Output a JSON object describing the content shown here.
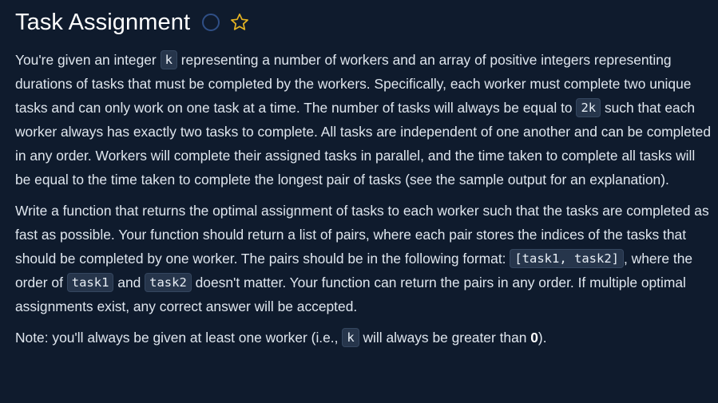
{
  "header": {
    "title": "Task Assignment",
    "status_icon": "circle-outline-icon",
    "favorite_icon": "star-outline-icon",
    "colors": {
      "background": "#0f1b2d",
      "circle": "#2f4f86",
      "star": "#e6b422"
    }
  },
  "body": {
    "p1": {
      "t1": "You're given an integer ",
      "c1": "k",
      "t2": " representing a number of workers and an array of positive integers representing durations of tasks that must be completed by the workers. Specifically, each worker must complete two unique tasks and can only work on one task at a time. The number of tasks will always be equal to ",
      "c2": "2k",
      "t3": " such that each worker always has exactly two tasks to complete. All tasks are independent of one another and can be completed in any order. Workers will complete their assigned tasks in parallel, and the time taken to complete all tasks will be equal to the time taken to complete the longest pair of tasks (see the sample output for an explanation)."
    },
    "p2": {
      "t1": "Write a function that returns the optimal assignment of tasks to each worker such that the tasks are completed as fast as possible. Your function should return a list of pairs, where each pair stores the indices of the tasks that should be completed by one worker. The pairs should be in the following format: ",
      "c1": "[task1, task2]",
      "t2": ", where the order of ",
      "c2": "task1",
      "t3": " and ",
      "c3": "task2",
      "t4": " doesn't matter. Your function can return the pairs in any order. If multiple optimal assignments exist, any correct answer will be accepted."
    },
    "p3": {
      "t1": "Note: you'll always be given at least one worker (i.e., ",
      "c1": "k",
      "t2": " will always be greater than ",
      "b1": "0",
      "t3": ")."
    }
  }
}
